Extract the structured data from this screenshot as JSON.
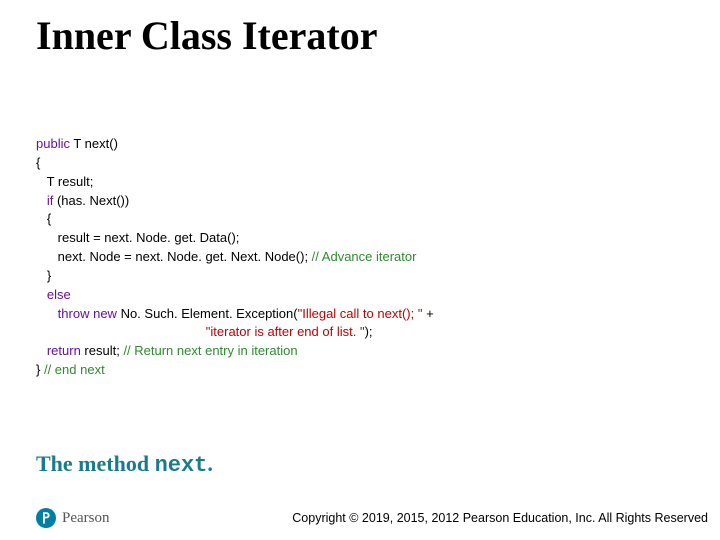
{
  "title": "Inner Class Iterator",
  "code": {
    "kw_public": "public",
    "sig": " T next()",
    "l2": "{",
    "l3": "   T result;",
    "kw_if": "if",
    "l4b": " (has. Next())",
    "l5": "   {",
    "l6": "      result = next. Node. get. Data();",
    "l7a": "      next. Node = next. Node. get. Next. Node(); ",
    "c7": "// Advance iterator",
    "l8": "   }",
    "kw_else": "else",
    "kw_throw": "throw",
    "kw_new": "new",
    "l10b": " No. Such. Element. Exception(",
    "s10": "\"Illegal call to next(); \"",
    "l10c": " +",
    "l11pad": "                                               ",
    "s11": "\"iterator is after end of list. \"",
    "l11b": ");",
    "kw_return": "return",
    "l12b": " result; ",
    "c12": "// Return next entry in iteration",
    "l13a": "} ",
    "c13": "// end next"
  },
  "caption": {
    "prefix": "The method ",
    "mono": "next",
    "suffix": "."
  },
  "brand": "Pearson",
  "logo": {
    "bg": "#007fa3",
    "fg": "#ffffff"
  },
  "copyright": "Copyright © 2019, 2015, 2012 Pearson Education, Inc. All Rights Reserved"
}
